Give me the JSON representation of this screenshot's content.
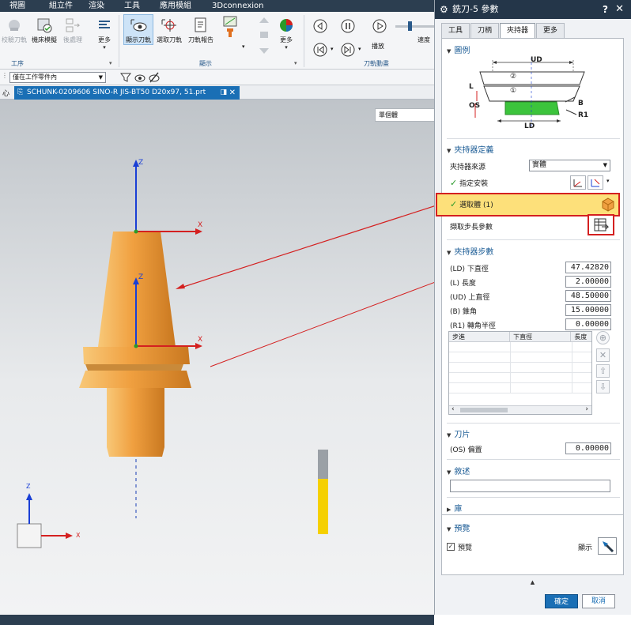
{
  "menu": [
    "視圖",
    "組立件",
    "渲染",
    "工具",
    "應用模組",
    "3Dconnexion"
  ],
  "ribbon": {
    "buttons": {
      "verify_toolpath": "校驗刀軌",
      "machine_sim": "機床模擬",
      "post_process": "後處理",
      "more_1": "更多",
      "show_toolpath": "顯示刀軌",
      "select_toolpath": "選取刀軌",
      "toolpath_report": "刀軌報告",
      "more_2": "更多",
      "play": "播放",
      "speed": "速度"
    },
    "groups": {
      "workpiece": "工序",
      "display": "顯示",
      "toolpath_motion": "刀軌動畫"
    }
  },
  "selection": {
    "filter": "僅在工作零件內"
  },
  "document_tab": {
    "prefix": "心",
    "name": "SCHUNK-0209606 SINO-R JIS-BT50 D20x97, 51.prt"
  },
  "viewport": {
    "render_mode": "單個體",
    "axes": {
      "z": "Z",
      "x": "X"
    }
  },
  "dialog": {
    "title": "銑刀-5 參數",
    "help": "?",
    "close": "✕",
    "tabs": [
      {
        "label": "工具",
        "active": false
      },
      {
        "label": "刀柄",
        "active": false
      },
      {
        "label": "夾持器",
        "active": true
      },
      {
        "label": "更多",
        "active": false
      }
    ],
    "diagram": {
      "title": "圖例",
      "labels": {
        "ud": "UD",
        "ld": "LD",
        "l": "L",
        "os": "OS",
        "b": "B",
        "r1": "R1",
        "c1": "①",
        "c2": "②"
      }
    },
    "holder_def": {
      "title": "夾持器定義",
      "source_label": "夾持器來源",
      "source_value": "實體",
      "specify_install": "指定安裝",
      "select_body": "選取體 (1)",
      "extract_params": "擷取步長參數"
    },
    "holder_steps": {
      "title": "夾持器步數",
      "fields": [
        {
          "label": "(LD) 下直徑",
          "value": "47.42820"
        },
        {
          "label": "(L) 長度",
          "value": "2.00000"
        },
        {
          "label": "(UD) 上直徑",
          "value": "48.50000"
        },
        {
          "label": "(B) 錐角",
          "value": "15.00000"
        },
        {
          "label": "(R1) 轉角半徑",
          "value": "0.00000"
        }
      ],
      "table": {
        "columns": [
          "步進",
          "下直徑",
          "長度"
        ]
      }
    },
    "blade": {
      "title": "刀片",
      "offset_label": "(OS) 偏置",
      "offset_value": "0.00000"
    },
    "description": {
      "title": "敘述",
      "value": ""
    },
    "library": {
      "title": "庫"
    },
    "preview": {
      "title": "預覽",
      "checkbox_label": "預覽",
      "checked": true,
      "show_label": "顯示"
    },
    "buttons": {
      "ok": "確定",
      "cancel": "取消"
    }
  },
  "colors": {
    "accent": "#1a6fb5",
    "tool_orange": "#f0a040",
    "highlight_yellow": "#fde07a",
    "annotation_red": "#d42020",
    "title_bar": "#243649"
  }
}
